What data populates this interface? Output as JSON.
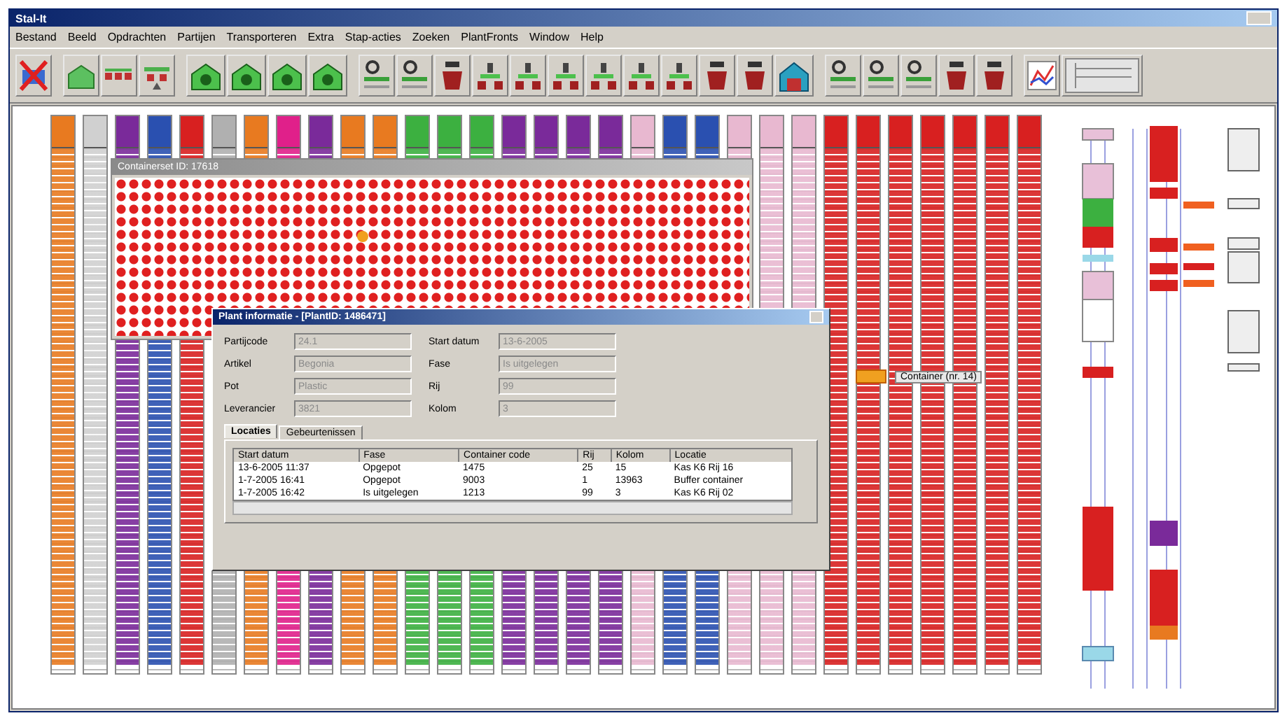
{
  "window": {
    "title": "Stal-It"
  },
  "menu": [
    "Bestand",
    "Beeld",
    "Opdrachten",
    "Partijen",
    "Transporteren",
    "Extra",
    "Stap-acties",
    "Zoeken",
    "PlantFronts",
    "Window",
    "Help"
  ],
  "toolbar": [
    {
      "kind": "delete"
    },
    {
      "kind": "greenhouse"
    },
    {
      "kind": "tray"
    },
    {
      "kind": "bench"
    },
    {
      "kind": "plant"
    },
    {
      "kind": "plant"
    },
    {
      "kind": "plant"
    },
    {
      "kind": "plant"
    },
    {
      "kind": "sensor"
    },
    {
      "kind": "sensor"
    },
    {
      "kind": "pot"
    },
    {
      "kind": "seedling"
    },
    {
      "kind": "seedling"
    },
    {
      "kind": "seedling"
    },
    {
      "kind": "seedling"
    },
    {
      "kind": "seedling"
    },
    {
      "kind": "seedling"
    },
    {
      "kind": "pot"
    },
    {
      "kind": "pot"
    },
    {
      "kind": "station"
    },
    {
      "kind": "sensor"
    },
    {
      "kind": "sensor"
    },
    {
      "kind": "sensor"
    },
    {
      "kind": "pot"
    },
    {
      "kind": "pot"
    },
    {
      "kind": "chart"
    },
    {
      "kind": "layout"
    }
  ],
  "racks": [
    {
      "color": "#e87a20"
    },
    {
      "color": "#d0d0d0"
    },
    {
      "color": "#7a2a9a"
    },
    {
      "color": "#2a50b0"
    },
    {
      "color": "#d82020"
    },
    {
      "color": "#b0b0b0"
    },
    {
      "color": "#e87a20"
    },
    {
      "color": "#e0208a"
    },
    {
      "color": "#7a2a9a"
    },
    {
      "color": "#e87a20"
    },
    {
      "color": "#e87a20"
    },
    {
      "color": "#3cb040"
    },
    {
      "color": "#3cb040"
    },
    {
      "color": "#3cb040"
    },
    {
      "color": "#7a2a9a"
    },
    {
      "color": "#7a2a9a"
    },
    {
      "color": "#7a2a9a"
    },
    {
      "color": "#7a2a9a"
    },
    {
      "color": "#e8b8d0"
    },
    {
      "color": "#2a50b0"
    },
    {
      "color": "#2a50b0"
    },
    {
      "color": "#e8b8d0"
    },
    {
      "color": "#e8b8d0"
    },
    {
      "color": "#e8b8d0"
    },
    {
      "color": "#d82020"
    },
    {
      "color": "#d82020"
    },
    {
      "color": "#d82020"
    },
    {
      "color": "#d82020"
    },
    {
      "color": "#d82020"
    },
    {
      "color": "#d82020"
    },
    {
      "color": "#d82020"
    }
  ],
  "container_window": {
    "title": "Containerset ID: 17618"
  },
  "container_tag": {
    "label": "Container (nr. 14)"
  },
  "plant_dialog": {
    "title": "Plant informatie - [PlantID: 1486471]",
    "fields": [
      {
        "label": "Partijcode",
        "value": "24.1"
      },
      {
        "label": "Start datum",
        "value": "13-6-2005"
      },
      {
        "label": "Artikel",
        "value": "Begonia"
      },
      {
        "label": "Fase",
        "value": "Is uitgelegen"
      },
      {
        "label": "Pot",
        "value": "Plastic"
      },
      {
        "label": "Rij",
        "value": "99"
      },
      {
        "label": "Leverancier",
        "value": "3821"
      },
      {
        "label": "Kolom",
        "value": "3"
      }
    ],
    "tabs": [
      {
        "label": "Locaties",
        "selected": true
      },
      {
        "label": "Gebeurtenissen",
        "selected": false
      }
    ],
    "table": {
      "columns": [
        "Start datum",
        "Fase",
        "Container code",
        "Rij",
        "Kolom",
        "Locatie"
      ],
      "rows": [
        [
          "13-6-2005 11:37",
          "Opgepot",
          "1475",
          "25",
          "15",
          "Kas K6 Rij 16"
        ],
        [
          "1-7-2005 16:41",
          "Opgepot",
          "9003",
          "1",
          "13963",
          "Buffer container"
        ],
        [
          "1-7-2005 16:42",
          "Is uitgelegen",
          "1213",
          "99",
          "3",
          "Kas K6 Rij 02"
        ]
      ]
    }
  }
}
